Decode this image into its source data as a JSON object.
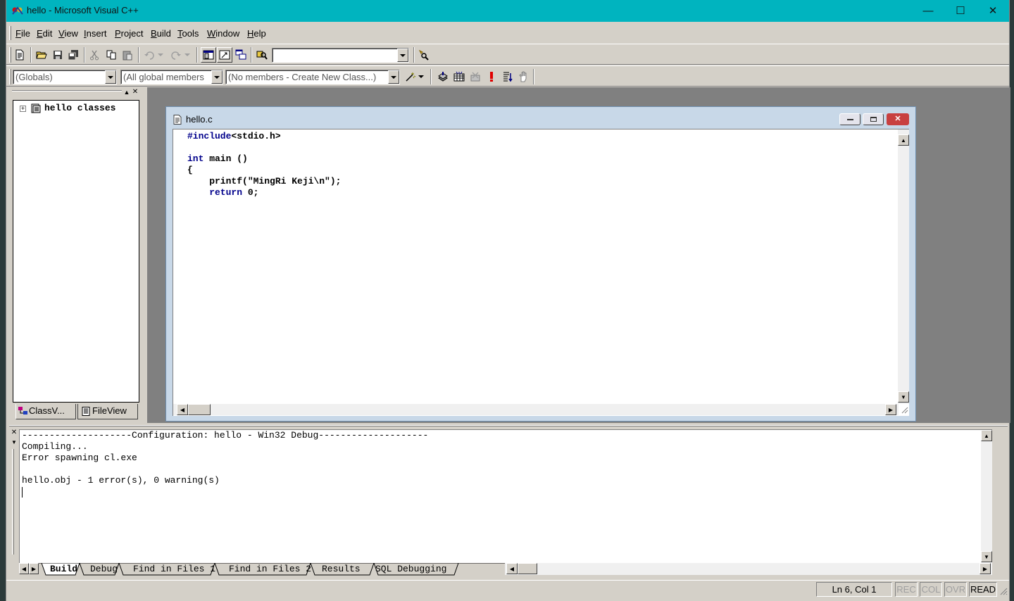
{
  "window": {
    "title": "hello - Microsoft Visual C++",
    "minimize": "—",
    "maximize": "☐",
    "close": "✕"
  },
  "menubar": [
    {
      "key": "F",
      "rest": "ile"
    },
    {
      "key": "E",
      "rest": "dit"
    },
    {
      "key": "V",
      "rest": "iew"
    },
    {
      "key": "I",
      "rest": "nsert"
    },
    {
      "key": "P",
      "rest": "roject"
    },
    {
      "key": "B",
      "rest": "uild"
    },
    {
      "key": "T",
      "rest": "ools"
    },
    {
      "key": "W",
      "rest": "indow"
    },
    {
      "key": "H",
      "rest": "elp"
    }
  ],
  "toolbar": {
    "find_combo_value": ""
  },
  "wizardbar": {
    "class_combo": "(Globals)",
    "filter_combo": "(All global members",
    "members_combo": "(No members - Create New Class...)"
  },
  "workspace": {
    "tree_root": "hello classes",
    "tab_classview": "ClassV...",
    "tab_fileview": "FileView"
  },
  "editor": {
    "title": "hello.c",
    "lines": [
      {
        "kw": "#include",
        "text": "<stdio.h>"
      },
      {
        "kw": "",
        "text": ""
      },
      {
        "kw": "int",
        "text": " main ()"
      },
      {
        "kw": "",
        "text": "{"
      },
      {
        "kw": "",
        "text": "    printf(\"MingRi Keji\\n\");"
      },
      {
        "kw": "    return",
        "text": " 0;"
      }
    ]
  },
  "output": {
    "lines": [
      "--------------------Configuration: hello - Win32 Debug--------------------",
      "Compiling...",
      "Error spawning cl.exe",
      "",
      "hello.obj - 1 error(s), 0 warning(s)"
    ],
    "tabs": [
      "Build",
      "Debug",
      "Find in Files 1",
      "Find in Files 2",
      "Results",
      "SQL Debugging"
    ],
    "active_tab": "Build"
  },
  "statusbar": {
    "position": "Ln 6, Col 1",
    "rec": "REC",
    "col": "COL",
    "ovr": "OVR",
    "read": "READ"
  }
}
